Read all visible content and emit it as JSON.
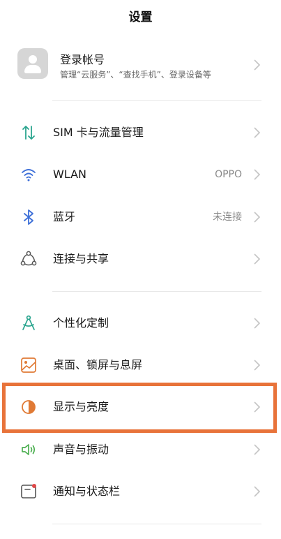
{
  "header": {
    "title": "设置"
  },
  "account": {
    "title": "登录帐号",
    "subtitle": "管理“云服务”、“查找手机”、登录设备等"
  },
  "items": [
    {
      "label": "SIM 卡与流量管理",
      "value": "",
      "icon": "sim-data-icon"
    },
    {
      "label": "WLAN",
      "value": "OPPO",
      "icon": "wifi-icon"
    },
    {
      "label": "蓝牙",
      "value": "未连接",
      "icon": "bluetooth-icon"
    },
    {
      "label": "连接与共享",
      "value": "",
      "icon": "connection-share-icon"
    },
    {
      "label": "个性化定制",
      "value": "",
      "icon": "personalization-icon"
    },
    {
      "label": "桌面、锁屏与息屏",
      "value": "",
      "icon": "wallpaper-icon"
    },
    {
      "label": "显示与亮度",
      "value": "",
      "icon": "display-brightness-icon"
    },
    {
      "label": "声音与振动",
      "value": "",
      "icon": "sound-vibration-icon"
    },
    {
      "label": "通知与状态栏",
      "value": "",
      "icon": "notification-icon"
    }
  ],
  "colors": {
    "highlight": "#e8733a",
    "teal": "#2ba58f",
    "blue": "#3d6fd8",
    "orange": "#e07a35",
    "green": "#4caf50",
    "red": "#e04848"
  }
}
